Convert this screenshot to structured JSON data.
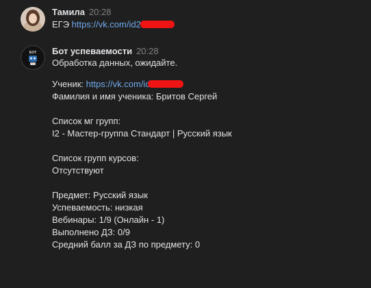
{
  "messages": [
    {
      "author": "Тамила",
      "time": "20:28",
      "text_prefix": "ЕГЭ ",
      "link": "https://vk.com/id2"
    },
    {
      "author": "Бот успеваемости",
      "time": "20:28",
      "avatar_text": "БОТ",
      "lines": {
        "status": "Обработка данных, ожидайте.",
        "student_label": "Ученик: ",
        "student_link": "https://vk.com/id",
        "name": "Фамилия и имя ученика: Бритов Сергей",
        "mg_header": "Список мг групп:",
        "mg_item": "I2 - Мастер-группа Стандарт | Русский язык",
        "course_header": "Список групп курсов:",
        "course_item": "Отсутствуют",
        "subject": "Предмет: Русский язык",
        "performance": "Успеваемость: низкая",
        "webinars": "Вебинары: 1/9 (Онлайн - 1)",
        "homework": "Выполнено ДЗ: 0/9",
        "avg_score": "Средний балл за ДЗ по предмету: 0"
      }
    }
  ],
  "colors": {
    "background": "#1f1f1f",
    "text": "#e1e3e6",
    "link": "#71aaeb",
    "time": "#828282",
    "redaction": "#f01414"
  }
}
